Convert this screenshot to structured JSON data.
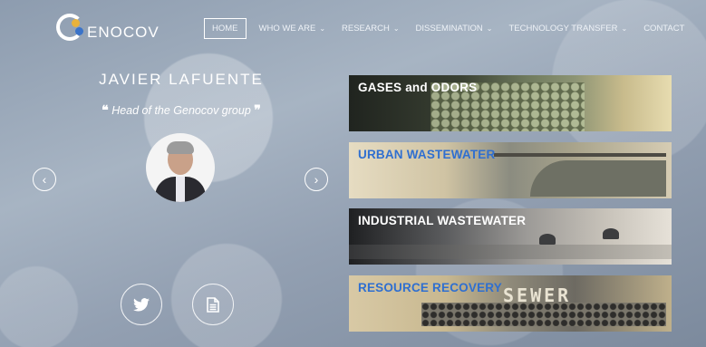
{
  "logo": {
    "text": "ENOCOV"
  },
  "nav": {
    "items": [
      {
        "label": "HOME",
        "active": true,
        "caret": ""
      },
      {
        "label": "WHO WE ARE",
        "active": false,
        "caret": "⌄"
      },
      {
        "label": "RESEARCH",
        "active": false,
        "caret": "⌄"
      },
      {
        "label": "DISSEMINATION",
        "active": false,
        "caret": "⌄"
      },
      {
        "label": "TECHNOLOGY TRANSFER",
        "active": false,
        "caret": "⌄"
      },
      {
        "label": "CONTACT",
        "active": false,
        "caret": ""
      }
    ]
  },
  "profile": {
    "name": "JAVIER LAFUENTE",
    "role": "Head of the Genocov group",
    "quote_open": "❝",
    "quote_close": "❞"
  },
  "carousel": {
    "prev": "‹",
    "next": "›"
  },
  "social": {
    "twitter_icon": "twitter-icon",
    "document_icon": "document-icon"
  },
  "banners": [
    {
      "label": "GASES and ODORS",
      "color": "#ffffff"
    },
    {
      "label": "URBAN WASTEWATER",
      "color": "#2f6fd0"
    },
    {
      "label": "INDUSTRIAL WASTEWATER",
      "color": "#ffffff"
    },
    {
      "label": "RESOURCE RECOVERY",
      "color": "#2f6fd0"
    }
  ],
  "banner_art": {
    "sewer_text": "SEWER"
  }
}
